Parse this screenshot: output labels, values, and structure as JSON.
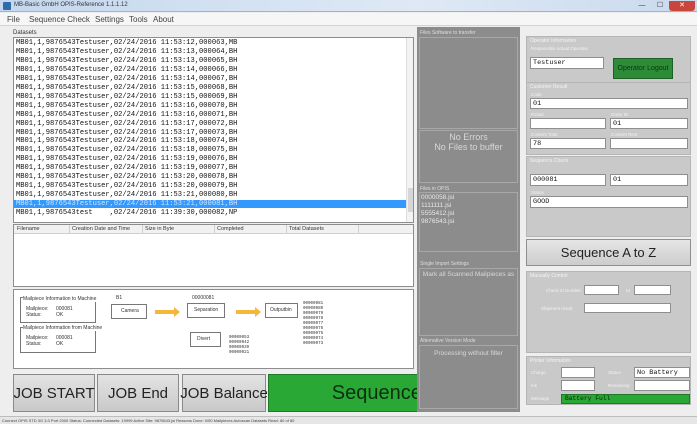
{
  "window": {
    "title": "MB-Basic GmbH OPIS-Reference 1.1.1.12",
    "min": "—",
    "max": "☐",
    "close": "✕"
  },
  "menu": [
    "File",
    "Sequence Check",
    "Settings",
    "Tools",
    "About"
  ],
  "datasets": {
    "label": "Datasets",
    "rows": [
      "MB01,1,9876543Testuser,02/24/2016 11:53:12,000063,MB",
      "MB01,1,9876543Testuser,02/24/2016 11:53:13,000064,BH",
      "MB01,1,9876543Testuser,02/24/2016 11:53:13,000065,BH",
      "MB01,1,9876543Testuser,02/24/2016 11:53:14,000066,BH",
      "MB01,1,9876543Testuser,02/24/2016 11:53:14,000067,BH",
      "MB01,1,9876543Testuser,02/24/2016 11:53:15,000068,BH",
      "MB01,1,9876543Testuser,02/24/2016 11:53:15,000069,BH",
      "MB01,1,9876543Testuser,02/24/2016 11:53:16,000070,BH",
      "MB01,1,9876543Testuser,02/24/2016 11:53:16,000071,BH",
      "MB01,1,9876543Testuser,02/24/2016 11:53:17,000072,BH",
      "MB01,1,9876543Testuser,02/24/2016 11:53:17,000073,BH",
      "MB01,1,9876543Testuser,02/24/2016 11:53:18,000074,BH",
      "MB01,1,9876543Testuser,02/24/2016 11:53:18,000075,BH",
      "MB01,1,9876543Testuser,02/24/2016 11:53:19,000076,BH",
      "MB01,1,9876543Testuser,02/24/2016 11:53:19,000077,BH",
      "MB01,1,9876543Testuser,02/24/2016 11:53:20,000078,BH",
      "MB01,1,9876543Testuser,02/24/2016 11:53:20,000079,BH",
      "MB01,1,9876543Testuser,02/24/2016 11:53:21,000080,BH",
      "MB01,1,9876543Testuser,02/24/2016 11:53:21,000081,BH",
      "MB01,1,9876543test    ,02/24/2016 11:39:30,000082,NP"
    ]
  },
  "file_table": {
    "headers": [
      "Filename",
      "Creation Date and Time",
      "Size in Byte",
      "Completed",
      "Total Datasets"
    ]
  },
  "diagram": {
    "to_machine_title": "Mailpiece Information to Machine",
    "from_machine_title": "Mailpiece Information from Machine",
    "mailpiece_label": "Mailpiece:",
    "status_label": "Status:",
    "to_mailpiece": "000081",
    "to_status": "OK",
    "from_mailpiece": "000081",
    "from_status": "OK",
    "col_b1": "B1",
    "top_id": "00000081",
    "camera": "Camera",
    "separation": "Separation",
    "outputbin": "Outputbin",
    "divert": "Divert",
    "out_list": "00000081\n00000080\n00000079\n00000078\n00000077\n00000076\n00000075\n00000074\n00000073",
    "divert_list": "00000053\n00000042\n00000039\n00000021"
  },
  "buttons": {
    "job_start": "JOB START",
    "job_end": "JOB End",
    "job_balance": "JOB Balance",
    "sequence_ok": "Sequence OK",
    "sequence_az": "Sequence A to Z",
    "logout": "Operator Logout"
  },
  "middle": {
    "files_title": "Files Software to transfer",
    "no_errors": "No Errors",
    "no_files": "No Files to buffer",
    "files_opis_title": "Files in OPIS",
    "files": "0000058.jsi\n1111111.jsi\n5555412.jsi\n9876543.jsi",
    "scan_title": "Single Import Settings",
    "scan_text": "Mark all Scanned Mailpieces as",
    "alt_title": "Alternative Version Mode",
    "alt_text": "Processing without filter"
  },
  "operator": {
    "title": "Operator Information",
    "field_label": "Responsible actual Operator",
    "value": "Testuser"
  },
  "customer": {
    "title": "Customer Result",
    "c1_label": "Code",
    "c1": "01",
    "c2_label": "Postal",
    "c3_label": "Order ID",
    "c3": "01",
    "c4_label": "Content Total",
    "c4": "78",
    "c5_label": "Content Rest"
  },
  "sequence": {
    "title": "Sequence Check",
    "n_label": "",
    "n": "000081",
    "n2": "01",
    "status_label": "Status",
    "status": "GOOD"
  },
  "manual": {
    "title": "Manually Control",
    "f1": "Check Id Number",
    "f2": "Id",
    "f3": "Shipment result"
  },
  "printer": {
    "title": "Printer Information",
    "p1": "Charge",
    "p2": "Status",
    "status": "No Battery",
    "p3": "Ink",
    "p4": "Remaining",
    "p5": "Message",
    "message": "Battery Full"
  },
  "statusbar": "Connect OPIS STD 3G 3.0 Port 2000  Status: Connected  Datasets: 19999  Active Site: 9876543.jsi  Reasons Done: 0/50 Mailpieces  Autoscan Datasets Read: 80 of 80"
}
